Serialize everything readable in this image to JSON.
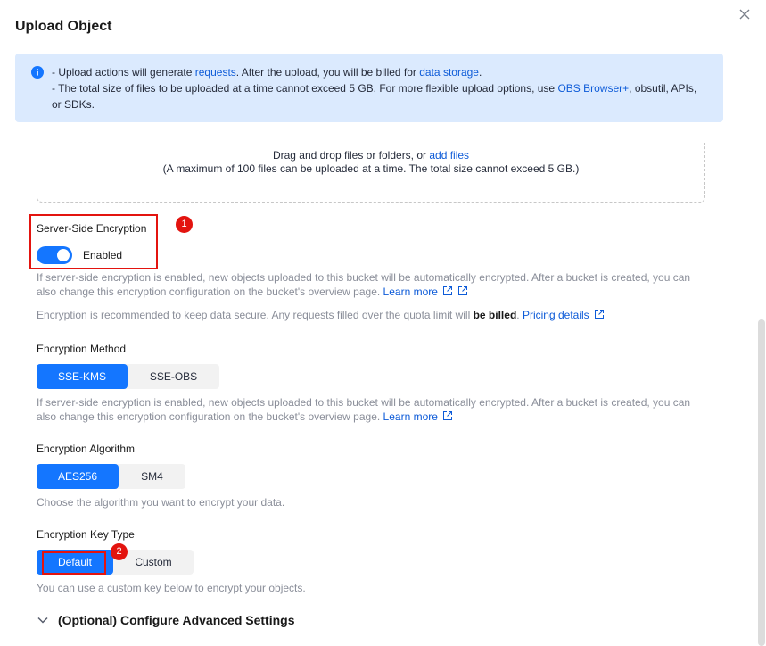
{
  "dialog": {
    "title": "Upload Object"
  },
  "notice": {
    "line1": {
      "p1": "- Upload actions will generate ",
      "link1": "requests",
      "p2": ". After the upload, you will be billed for ",
      "link2": "data storage",
      "p3": "."
    },
    "line2": {
      "p1": "- The total size of files to be uploaded at a time cannot exceed 5 GB. For more flexible upload options, use ",
      "link1": "OBS Browser+",
      "p2": ", obsutil, APIs,"
    },
    "line3": "or SDKs."
  },
  "dropzone": {
    "text": "Drag and drop files or folders, or ",
    "link": "add files",
    "limit": "(A maximum of 100 files can be uploaded at a time. The total size cannot exceed 5 GB.)"
  },
  "sse": {
    "label": "Server-Side Encryption",
    "toggle_label": "Enabled",
    "help1_a": "If server-side encryption is enabled, new objects uploaded to this bucket will be automatically encrypted. After a bucket is created, you can",
    "help1_b": "also change this encryption configuration on the bucket's overview page.",
    "learn_more": "Learn more",
    "help2_a": "Encryption is recommended to keep data secure. Any requests filled over the quota limit will ",
    "help2_bold": "be billed",
    "help2_b": ".",
    "pricing": "Pricing details"
  },
  "method": {
    "label": "Encryption Method",
    "options": [
      "SSE-KMS",
      "SSE-OBS"
    ],
    "selected": "SSE-KMS",
    "help_a": "If server-side encryption is enabled, new objects uploaded to this bucket will be automatically encrypted. After a bucket is created, you can",
    "help_b": "also change this encryption configuration on the bucket's overview page.",
    "learn_more": "Learn more"
  },
  "algorithm": {
    "label": "Encryption Algorithm",
    "options": [
      "AES256",
      "SM4"
    ],
    "selected": "AES256",
    "help": "Choose the algorithm you want to encrypt your data."
  },
  "keytype": {
    "label": "Encryption Key Type",
    "options": [
      "Default",
      "Custom"
    ],
    "selected": "Default",
    "help": "You can use a custom key below to encrypt your objects."
  },
  "advanced": {
    "label": "(Optional) Configure Advanced Settings"
  },
  "annotations": {
    "badge1": "1",
    "badge2": "2"
  },
  "colors": {
    "primary": "#1476ff",
    "link": "#0d5bd8",
    "notice_bg": "#dbeafe",
    "annotation": "#e3140f"
  },
  "icons": {
    "close": "close-icon",
    "info": "info-icon",
    "external": "external-link-icon",
    "chevron": "chevron-down-icon"
  }
}
